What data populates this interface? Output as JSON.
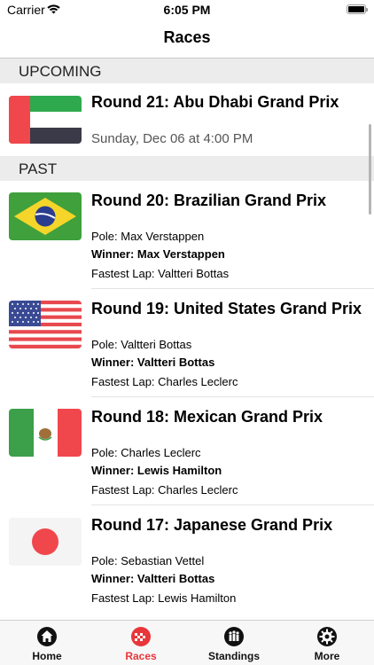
{
  "status": {
    "carrier": "Carrier",
    "time": "6:05 PM"
  },
  "nav": {
    "title": "Races"
  },
  "upcoming": {
    "header": "UPCOMING",
    "race": {
      "title": "Round 21: Abu Dhabi Grand Prix",
      "date": "Sunday, Dec 06 at 4:00 PM",
      "flag": "uae-flag"
    }
  },
  "past": {
    "header": "PAST",
    "races": [
      {
        "title": "Round 20: Brazilian Grand Prix",
        "pole": "Pole: Max Verstappen",
        "winner": "Winner: Max Verstappen",
        "fastest": "Fastest Lap: Valtteri Bottas",
        "flag": "brazil-flag"
      },
      {
        "title": "Round 19: United States Grand Prix",
        "pole": "Pole: Valtteri Bottas",
        "winner": "Winner: Valtteri Bottas",
        "fastest": "Fastest Lap: Charles Leclerc",
        "flag": "usa-flag"
      },
      {
        "title": "Round 18: Mexican Grand Prix",
        "pole": "Pole: Charles Leclerc",
        "winner": "Winner: Lewis Hamilton",
        "fastest": "Fastest Lap: Charles Leclerc",
        "flag": "mexico-flag"
      },
      {
        "title": "Round 17: Japanese Grand Prix",
        "pole": "Pole: Sebastian Vettel",
        "winner": "Winner: Valtteri Bottas",
        "fastest": "Fastest Lap: Lewis Hamilton",
        "flag": "japan-flag"
      }
    ]
  },
  "tabs": [
    {
      "label": "Home",
      "icon": "home-icon"
    },
    {
      "label": "Races",
      "icon": "checkered-flag-icon",
      "active": true
    },
    {
      "label": "Standings",
      "icon": "standings-icon"
    },
    {
      "label": "More",
      "icon": "gear-icon"
    }
  ],
  "colors": {
    "accent": "#e8363a",
    "section_bg": "#ececec"
  }
}
